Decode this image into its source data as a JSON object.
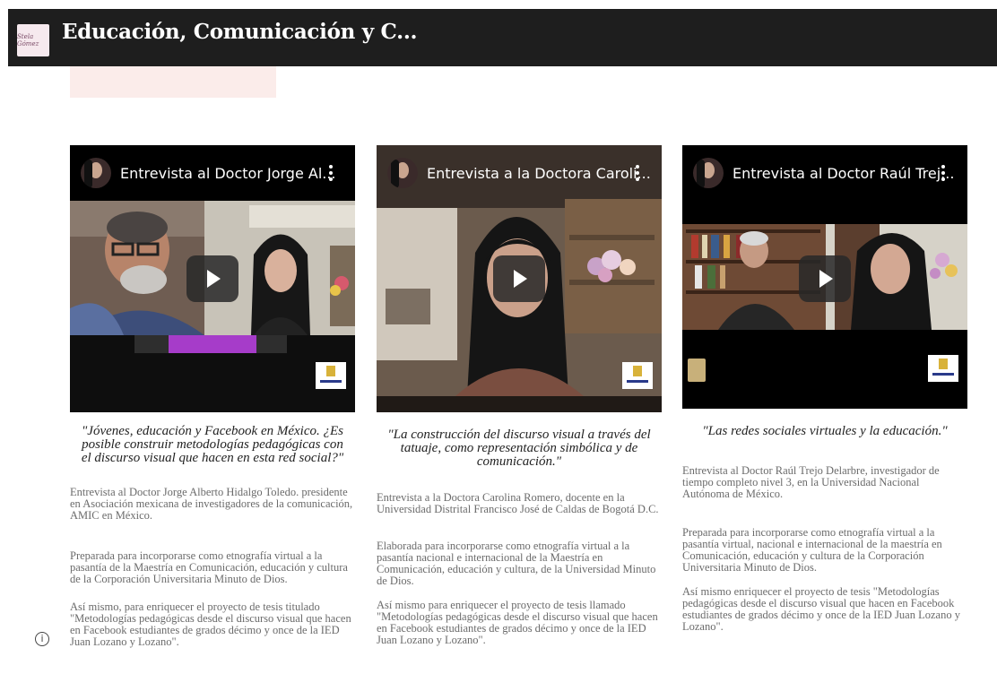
{
  "site": {
    "logo_text": "Stela Gómez",
    "title": "Educación, Comunicación y C..."
  },
  "videos": [
    {
      "title": "Entrevista al Doctor Jorge Al...",
      "quote": "\"Jóvenes, educación y Facebook en México. ¿Es posible construir metodologías pedagógicas con el discurso visual que hacen en esta red social?\"",
      "paragraphs": [
        "Entrevista al Doctor Jorge Alberto Hidalgo Toledo. presidente en Asociación mexicana de investigadores de la comunicación, AMIC en México.",
        "Preparada para incorporarse como etnografía virtual a la pasantía de la Maestría en Comunicación, educación y cultura de la Corporación Universitaria Minuto de Dios.",
        "Así mismo, para enriquecer el proyecto de tesis titulado \"Metodologías pedagógicas desde el discurso visual que hacen en Facebook estudiantes de grados décimo y once de la IED Juan Lozano y Lozano\"."
      ]
    },
    {
      "title": "Entrevista a la Doctora Caroli...",
      "quote": "\"La construcción del discurso visual a través del tatuaje, como representación simbólica y de comunicación.\"",
      "paragraphs": [
        "Entrevista a la Doctora Carolina Romero, docente en la Universidad Distrital Francisco José de Caldas de Bogotá D.C.",
        "Elaborada para incorporarse como etnografía virtual a la pasantía nacional e internacional de la Maestría en Comunicación, educación y cultura, de la Universidad Minuto de Dios.",
        "Así mismo para enriquecer el proyecto de tesis llamado \"Metodologías pedagógicas desde el discurso visual que hacen en Facebook estudiantes de grados décimo y once de la IED Juan Lozano y Lozano\"."
      ]
    },
    {
      "title": "Entrevista al Doctor Raúl Trej...",
      "quote": "\"Las redes sociales virtuales y la educación.\"",
      "paragraphs": [
        "Entrevista al Doctor Raúl Trejo Delarbre, investigador de tiempo completo nivel 3, en la Universidad Nacional Autónoma de México.",
        "Preparada para incorporarse como etnografía virtual a la pasantía virtual, nacional e internacional de la maestría en Comunicación, educación y cultura de la Corporación Universitaria Minuto de Dios.",
        "Así mismo enriquecer el proyecto de tesis \"Metodologías pedagógicas desde el discurso visual que hacen en Facebook estudiantes de grados décimo y once de la IED Juan Lozano y Lozano\"."
      ]
    }
  ],
  "colors": {
    "header_bg": "#1e1e1e",
    "banner_pink": "#fbecea",
    "video_bg": "#000000",
    "progress_purple": "#a63cc9"
  },
  "icons": [
    "play-icon",
    "kebab-menu-icon",
    "info-icon"
  ]
}
